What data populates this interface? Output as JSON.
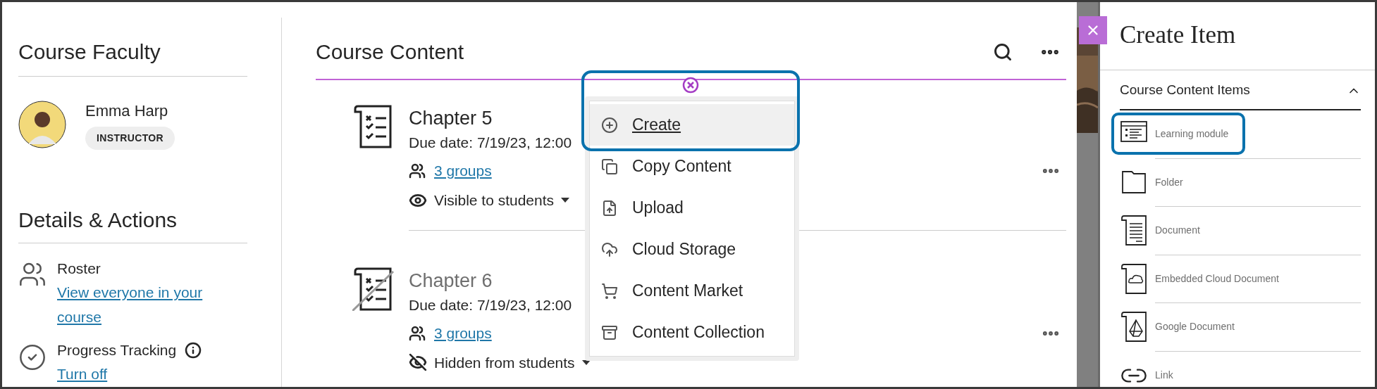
{
  "sidebar": {
    "faculty_title": "Course Faculty",
    "instructor": {
      "name": "Emma Harp",
      "role": "INSTRUCTOR"
    },
    "details_title": "Details & Actions",
    "actions": [
      {
        "kind": "roster",
        "title": "Roster",
        "link": "View everyone in your course"
      },
      {
        "kind": "progress",
        "title": "Progress Tracking",
        "link": "Turn off"
      }
    ]
  },
  "content": {
    "title": "Course Content",
    "items": [
      {
        "title": "Chapter 5",
        "visible": true,
        "due": "Due date: 7/19/23, 12:00",
        "groups": "3 groups",
        "visibility": "Visible to students"
      },
      {
        "title": "Chapter 6",
        "visible": false,
        "due": "Due date: 7/19/23, 12:00",
        "groups": "3 groups",
        "visibility": "Hidden from students"
      }
    ]
  },
  "add_menu": {
    "items": [
      {
        "kind": "create",
        "label": "Create",
        "selected": true,
        "highlighted": true
      },
      {
        "kind": "copy",
        "label": "Copy Content",
        "selected": false,
        "highlighted": false
      },
      {
        "kind": "upload",
        "label": "Upload",
        "selected": false,
        "highlighted": false
      },
      {
        "kind": "cloud",
        "label": "Cloud Storage",
        "selected": false,
        "highlighted": false
      },
      {
        "kind": "market",
        "label": "Content Market",
        "selected": false,
        "highlighted": false
      },
      {
        "kind": "collection",
        "label": "Content Collection",
        "selected": false,
        "highlighted": false
      }
    ]
  },
  "panel": {
    "title": "Create Item",
    "section": {
      "title": "Course Content Items",
      "expanded": true,
      "items": [
        {
          "kind": "module",
          "label": "Learning module",
          "highlighted": true
        },
        {
          "kind": "folder",
          "label": "Folder",
          "highlighted": false
        },
        {
          "kind": "document",
          "label": "Document",
          "highlighted": false
        },
        {
          "kind": "cloud_document",
          "label": "Embedded Cloud Document",
          "highlighted": false
        },
        {
          "kind": "google_document",
          "label": "Google Document",
          "highlighted": false
        },
        {
          "kind": "link",
          "label": "Link",
          "highlighted": false
        }
      ]
    }
  }
}
